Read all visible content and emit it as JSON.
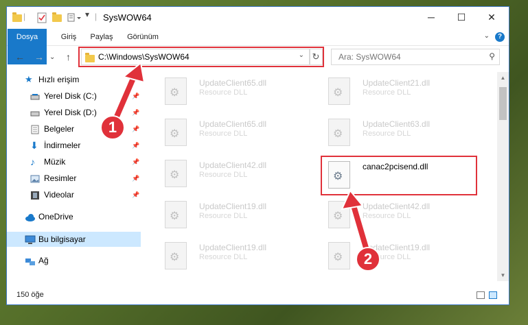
{
  "window": {
    "title": "SysWOW64"
  },
  "window_controls": {
    "minimize": "─",
    "maximize": "☐",
    "close": "✕"
  },
  "ribbon": {
    "tabs": [
      "Dosya",
      "Giriş",
      "Paylaş",
      "Görünüm"
    ],
    "help": "?"
  },
  "address": {
    "path": "C:\\Windows\\SysWOW64",
    "search_placeholder": "Ara: SysWOW64"
  },
  "sidebar": {
    "quick_access": "Hızlı erişim",
    "items": [
      {
        "label": "Yerel Disk (C:)",
        "icon": "drive-icon"
      },
      {
        "label": "Yerel Disk (D:)",
        "icon": "drive-icon"
      },
      {
        "label": "Belgeler",
        "icon": "documents-icon"
      },
      {
        "label": "İndirmeler",
        "icon": "download-icon"
      },
      {
        "label": "Müzik",
        "icon": "music-icon"
      },
      {
        "label": "Resimler",
        "icon": "pictures-icon"
      },
      {
        "label": "Videolar",
        "icon": "video-icon"
      }
    ],
    "onedrive": "OneDrive",
    "this_pc": "Bu bilgisayar",
    "network": "Ağ"
  },
  "files": [
    {
      "name": "UpdateClient65.dll",
      "desc": "Resource DLL"
    },
    {
      "name": "UpdateClient21.dll",
      "desc": "Resource DLL"
    },
    {
      "name": "UpdateClient65.dll",
      "desc": "Resource DLL"
    },
    {
      "name": "UpdateClient63.dll",
      "desc": "Resource DLL"
    },
    {
      "name": "UpdateClient42.dll",
      "desc": "Resource DLL"
    },
    {
      "name": "canac2pcisend.dll",
      "desc": ""
    },
    {
      "name": "UpdateClient19.dll",
      "desc": "Resource DLL"
    },
    {
      "name": "UpdateClient42.dll",
      "desc": "Resource DLL"
    },
    {
      "name": "UpdateClient19.dll",
      "desc": "Resource DLL"
    },
    {
      "name": "UpdateClient19.dll",
      "desc": "Resource DLL"
    }
  ],
  "status": {
    "count": "150 öğe"
  },
  "callouts": {
    "one": "1",
    "two": "2"
  },
  "colors": {
    "accent": "#1979ca",
    "highlight": "#e0313a"
  }
}
